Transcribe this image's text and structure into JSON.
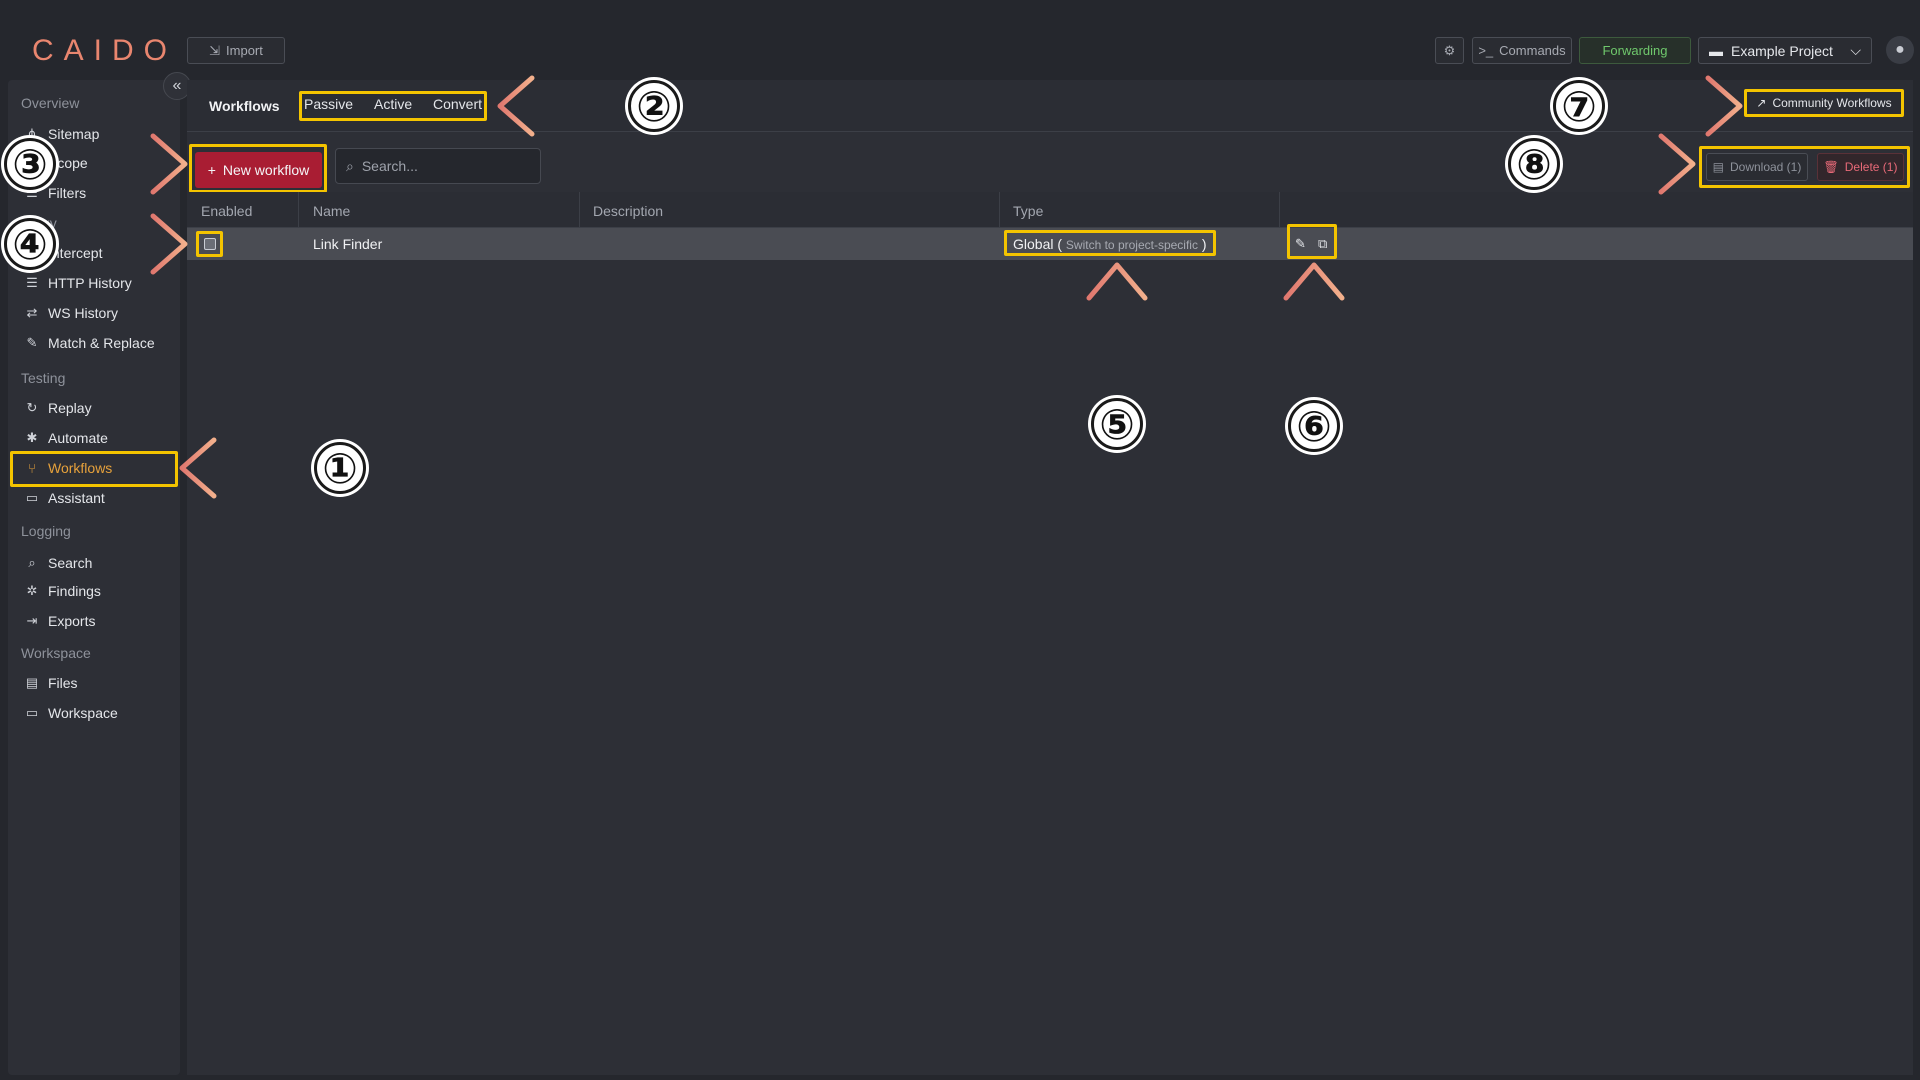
{
  "app": {
    "logo": "CAIDO"
  },
  "topbar": {
    "import_label": "Import",
    "commands_label": "Commands",
    "forwarding_label": "Forwarding",
    "project_label": "Example Project"
  },
  "sidebar": {
    "sections": [
      {
        "label": "Overview",
        "items": [
          {
            "label": "Sitemap",
            "icon": "sitemap-icon"
          },
          {
            "label": "Scope",
            "icon": "scope-icon"
          },
          {
            "label": "Filters",
            "icon": "filters-icon"
          }
        ]
      },
      {
        "label": "Proxy",
        "items": [
          {
            "label": "Intercept",
            "icon": "intercept-icon"
          },
          {
            "label": "HTTP History",
            "icon": "list-icon"
          },
          {
            "label": "WS History",
            "icon": "exchange-icon"
          },
          {
            "label": "Match & Replace",
            "icon": "wrench-icon"
          }
        ]
      },
      {
        "label": "Testing",
        "items": [
          {
            "label": "Replay",
            "icon": "replay-icon"
          },
          {
            "label": "Automate",
            "icon": "automate-icon"
          },
          {
            "label": "Workflows",
            "icon": "workflow-icon",
            "active": true
          },
          {
            "label": "Assistant",
            "icon": "chat-icon"
          }
        ]
      },
      {
        "label": "Logging",
        "items": [
          {
            "label": "Search",
            "icon": "search-icon"
          },
          {
            "label": "Findings",
            "icon": "bug-icon"
          },
          {
            "label": "Exports",
            "icon": "export-icon"
          }
        ]
      },
      {
        "label": "Workspace",
        "items": [
          {
            "label": "Files",
            "icon": "file-icon"
          },
          {
            "label": "Workspace",
            "icon": "monitor-icon"
          }
        ]
      }
    ]
  },
  "workflows": {
    "title": "Workflows",
    "tabs": [
      "Passive",
      "Active",
      "Convert"
    ],
    "community_label": "Community Workflows",
    "new_label": "New workflow",
    "search_placeholder": "Search...",
    "download_label": "Download (1)",
    "delete_label": "Delete (1)",
    "columns": [
      "Enabled",
      "Name",
      "Description",
      "Type"
    ],
    "rows": [
      {
        "name": "Link Finder",
        "description": "",
        "type": "Global",
        "switch_text": "Switch to project-specific",
        "enabled": false
      }
    ]
  },
  "annotations": {
    "labels": [
      "①",
      "②",
      "③",
      "④",
      "⑤",
      "⑥",
      "⑦",
      "⑧"
    ],
    "highlight_color": "#f4c400",
    "arrow_color": "#e0786f"
  }
}
